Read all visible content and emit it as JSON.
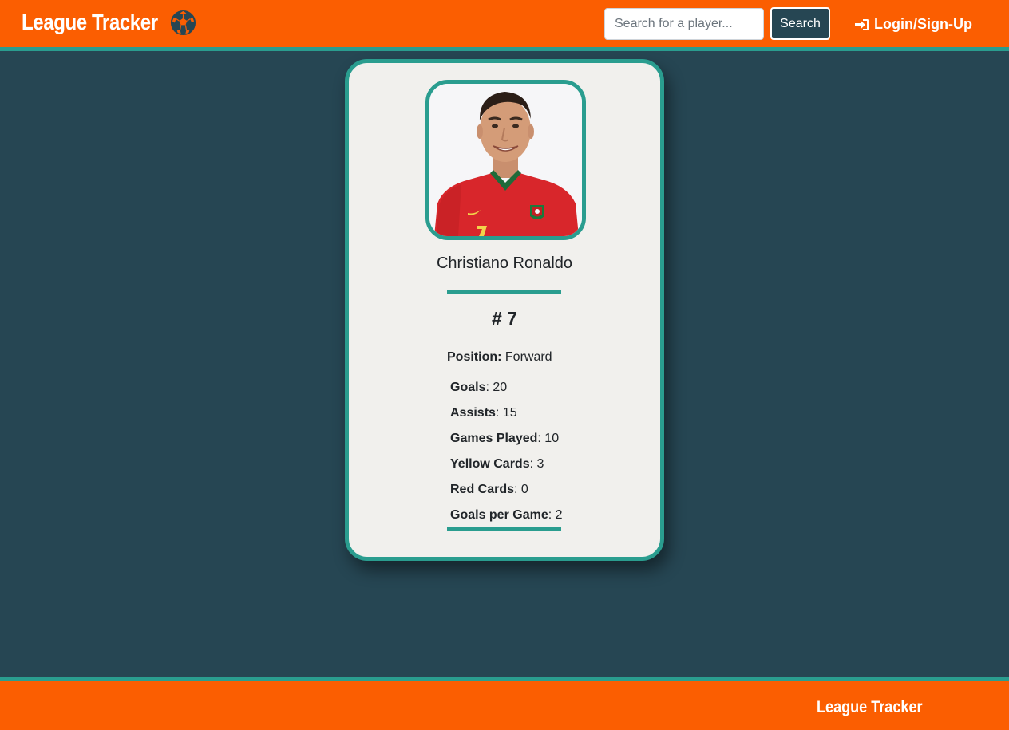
{
  "header": {
    "brand": "League Tracker",
    "brand_icon": "soccer-ball-icon",
    "search_placeholder": "Search for a player...",
    "search_label": "Search",
    "login_label": "Login/Sign-Up",
    "login_icon": "sign-in-icon",
    "colors": {
      "bar": "#fb5e01",
      "accent": "#2a9d8f",
      "background": "#264653"
    }
  },
  "player": {
    "name": "Christiano Ronaldo",
    "jersey": "# 7",
    "position_label": "Position:",
    "position_value": "Forward",
    "stats": [
      {
        "label": "Goals",
        "value": ": 20"
      },
      {
        "label": "Assists",
        "value": ": 15"
      },
      {
        "label": "Games Played",
        "value": ": 10"
      },
      {
        "label": "Yellow Cards",
        "value": ": 3"
      },
      {
        "label": "Red Cards",
        "value": ": 0"
      },
      {
        "label": "Goals per Game",
        "value": ": 2"
      }
    ]
  },
  "footer": {
    "brand": "League Tracker"
  }
}
